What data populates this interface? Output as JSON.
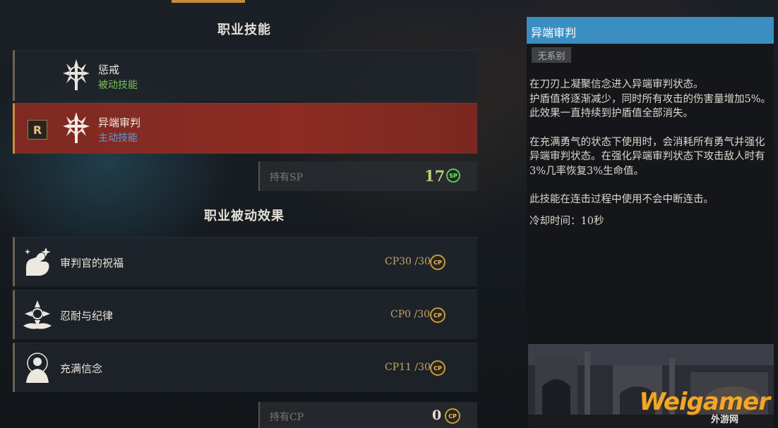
{
  "headings": {
    "class_skills": "职业技能",
    "class_passive": "职业被动效果"
  },
  "skills": [
    {
      "name": "惩戒",
      "type": "被动技能",
      "type_kind": "passive",
      "icon": "radiant-cross-sword-icon",
      "selected": false
    },
    {
      "name": "异端审判",
      "type": "主动技能",
      "type_kind": "active",
      "icon": "radiant-cross-sword-icon",
      "selected": true,
      "hotkey": "R"
    }
  ],
  "sp": {
    "label": "持有SP",
    "value": "17",
    "coin_text": "SP"
  },
  "passives": [
    {
      "name": "审判官的祝福",
      "cp": "CP30 /30",
      "icon": "flexed-arm-icon"
    },
    {
      "name": "忍耐与纪律",
      "cp": "CP0 /30",
      "icon": "winged-emblem-icon"
    },
    {
      "name": "充满信念",
      "cp": "CP11 /30",
      "icon": "praying-figure-icon"
    }
  ],
  "cp": {
    "label": "持有CP",
    "value": "0",
    "coin_text": "CP"
  },
  "detail": {
    "title": "异端审判",
    "tag": "无系别",
    "paragraphs": [
      "在刀刃上凝聚信念进入异端审判状态。\n护盾值将逐渐减少，同时所有攻击的伤害量增加5%。此效果一直持续到护盾值全部消失。",
      "在充满勇气的状态下使用时，会消耗所有勇气并强化异端审判状态。在强化异端审判状态下攻击敌人时有3%几率恢复3%生命值。",
      "此技能在连击过程中使用不会中断连击。"
    ],
    "cooldown": "冷却时间：10秒"
  },
  "watermark": {
    "main": "Weigamer",
    "sub": "外游网"
  },
  "colors": {
    "selected_row": "#8c2c24",
    "passive_type": "#79c25a",
    "active_type": "#5b9ce0",
    "detail_header": "#3a8ec2",
    "sp_value": "#b8d070",
    "cp_gold": "#c69a3e"
  }
}
